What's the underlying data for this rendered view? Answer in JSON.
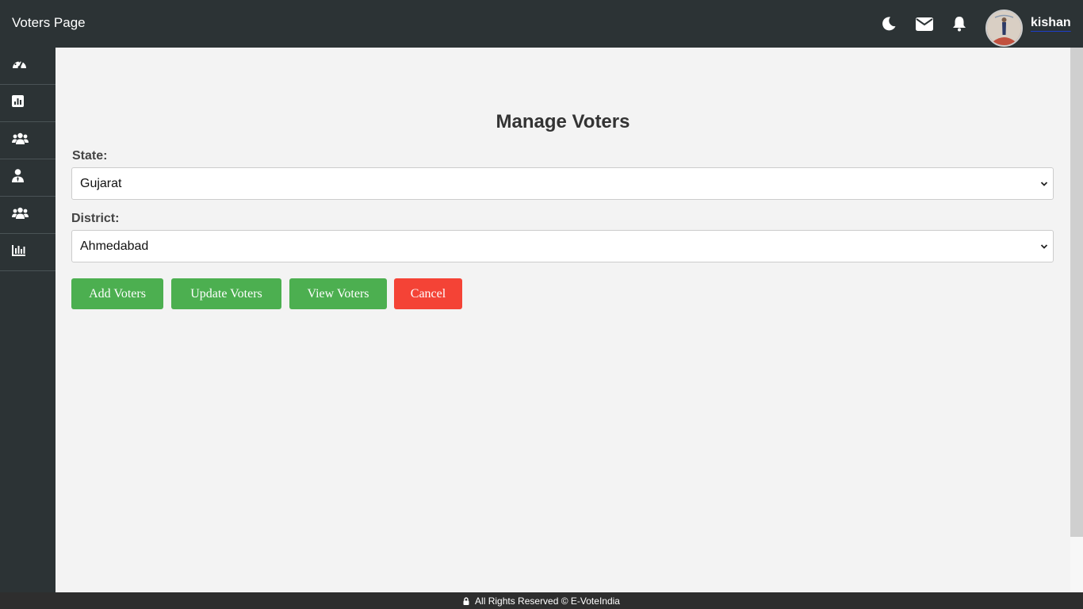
{
  "header": {
    "title": "Voters Page",
    "username": "kishan",
    "icons": [
      "moon-icon",
      "envelope-icon",
      "bell-icon"
    ]
  },
  "sidebar": {
    "items": [
      {
        "icon": "dashboard-gauge-icon"
      },
      {
        "icon": "bar-chart-icon"
      },
      {
        "icon": "users-group-icon"
      },
      {
        "icon": "user-tie-icon"
      },
      {
        "icon": "users-group-icon"
      },
      {
        "icon": "chart-columns-icon"
      }
    ]
  },
  "main": {
    "heading": "Manage Voters",
    "state_label": "State:",
    "state_value": "Gujarat",
    "district_label": "District:",
    "district_value": "Ahmedabad",
    "buttons": {
      "add": "Add Voters",
      "update": "Update Voters",
      "view": "View Voters",
      "cancel": "Cancel"
    }
  },
  "footer": {
    "text": "All Rights Reserved © E-VoteIndia"
  },
  "colors": {
    "green": "#4caf50",
    "red": "#f44336",
    "bar": "#2c3335"
  }
}
